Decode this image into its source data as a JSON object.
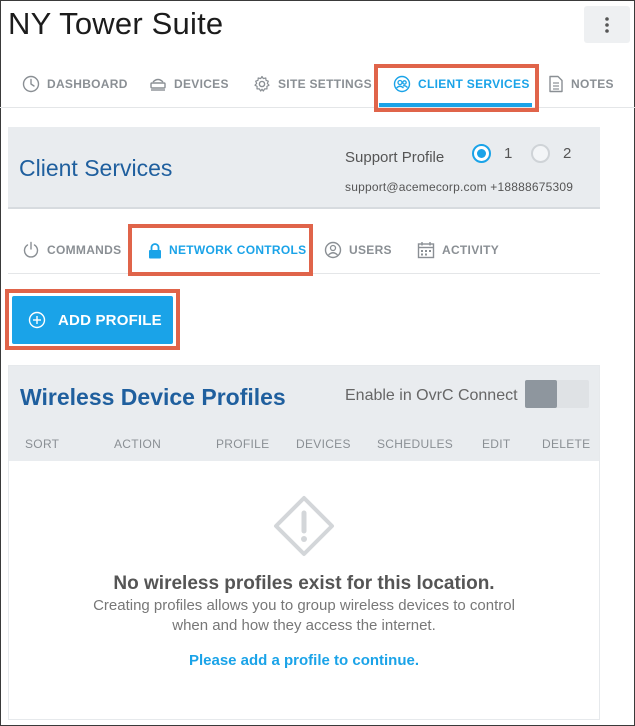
{
  "app": {
    "title": "NY Tower Suite",
    "more_icon": "kebab-vertical-icon"
  },
  "top_tabs": [
    {
      "label": "DASHBOARD",
      "icon": "dashboard-gauge-icon"
    },
    {
      "label": "DEVICES",
      "icon": "router-icon"
    },
    {
      "label": "SITE SETTINGS",
      "icon": "gear-icon"
    },
    {
      "label": "CLIENT SERVICES",
      "icon": "users-circle-icon",
      "active": true
    },
    {
      "label": "NOTES",
      "icon": "document-icon"
    }
  ],
  "client_services": {
    "title": "Client Services",
    "support_profile_label": "Support Profile",
    "profile_options": [
      "1",
      "2"
    ],
    "selected_profile": "1",
    "support_line": "support@acemecorp.com +18888675309"
  },
  "sub_tabs": [
    {
      "label": "COMMANDS",
      "icon": "power-icon"
    },
    {
      "label": "NETWORK CONTROLS",
      "icon": "lock-icon",
      "active": true
    },
    {
      "label": "USERS",
      "icon": "user-circle-icon"
    },
    {
      "label": "ACTIVITY",
      "icon": "calendar-icon"
    }
  ],
  "add_profile_button": {
    "label": "ADD PROFILE",
    "icon": "plus-circle-icon"
  },
  "wireless_profiles": {
    "title": "Wireless Device Profiles",
    "enable_label": "Enable in OvrC Connect",
    "enabled": false,
    "columns": [
      "SORT",
      "ACTION",
      "PROFILE",
      "DEVICES",
      "SCHEDULES",
      "EDIT",
      "DELETE"
    ],
    "empty_title": "No wireless profiles exist for this location.",
    "empty_desc_line1": "Creating profiles allows you to group wireless devices to control",
    "empty_desc_line2": "when and how they access the internet.",
    "empty_link": "Please add a profile to continue."
  },
  "colors": {
    "accent": "#1aa3e8",
    "highlight": "#e0644a",
    "heading_blue": "#1f5f9e"
  }
}
